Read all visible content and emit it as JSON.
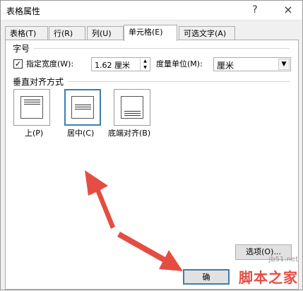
{
  "window": {
    "title": "表格属性"
  },
  "titlebar": {
    "help_icon": "?",
    "close_icon": "×"
  },
  "tabs": [
    {
      "label": "表格(T)"
    },
    {
      "label": "行(R)"
    },
    {
      "label": "列(U)"
    },
    {
      "label": "单元格(E)",
      "active": true
    },
    {
      "label": "可选文字(A)"
    }
  ],
  "cell": {
    "size_heading": "字号",
    "width_label": "指定宽度(W):",
    "width_value": "1.62 厘米",
    "units_label": "度量单位(M):",
    "units_value": "厘米",
    "valign_heading": "垂直对齐方式",
    "valign_options": [
      {
        "label": "上(P)"
      },
      {
        "label": "居中(C)",
        "selected": true
      },
      {
        "label": "底端对齐(B)"
      }
    ],
    "options_button": "选项(O)..."
  },
  "footer": {
    "ok_button": "确"
  },
  "watermark": {
    "url": "jb51.net",
    "text": "脚本之家"
  },
  "colors": {
    "accent": "#3c7fb1",
    "annotation_arrow": "#e54d42"
  }
}
